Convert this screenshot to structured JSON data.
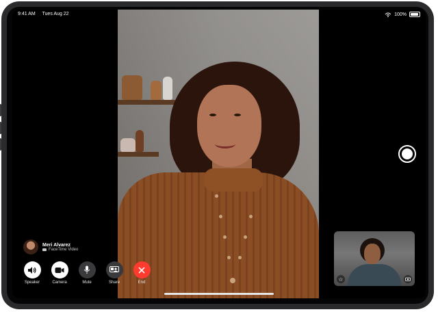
{
  "status_bar": {
    "time": "9:41 AM",
    "date": "Tues Aug 22",
    "battery": "100%"
  },
  "caller": {
    "name": "Meri Alvarez",
    "subtitle": "FaceTime Video"
  },
  "controls": [
    {
      "label": "Speaker"
    },
    {
      "label": "Camera"
    },
    {
      "label": "Mute"
    },
    {
      "label": "Share"
    },
    {
      "label": "End"
    }
  ],
  "icons": {
    "speaker": "speaker-icon",
    "camera": "video-camera-icon",
    "mute": "microphone-icon",
    "share": "screen-share-icon",
    "end": "close-icon",
    "shutter": "shutter-button",
    "effects": "star-icon",
    "flip": "camera-flip-icon"
  },
  "colors": {
    "end_call": "#ff3b30",
    "control_bg": "#3a3a3c"
  }
}
